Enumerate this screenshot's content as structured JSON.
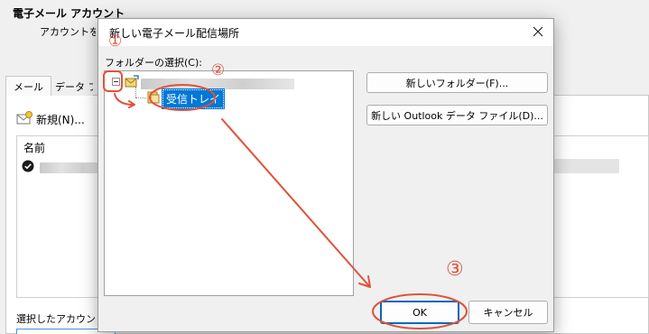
{
  "background": {
    "title": "電子メール アカウント",
    "description": "アカウントを追",
    "tabs": [
      {
        "label": "メール"
      },
      {
        "label": "データ ファ"
      }
    ],
    "new_button": "新規(N)...",
    "list_header": "名前",
    "bottom_label": "選択したアカウント"
  },
  "dialog": {
    "title": "新しい電子メール配信場所",
    "folder_label": "フォルダーの選択(C):",
    "tree": {
      "child_label": "受信トレイ"
    },
    "buttons": {
      "new_folder": "新しいフォルダー(F)...",
      "new_data_file": "新しい Outlook データ ファイル(D)...",
      "ok": "OK",
      "cancel": "キャンセル"
    }
  },
  "annotations": {
    "color": "#e0533a",
    "marks": [
      {
        "label": "①"
      },
      {
        "label": "②"
      },
      {
        "label": "③"
      }
    ]
  },
  "colors": {
    "selection": "#0078d7",
    "dialog_bg": "#f0f0f0",
    "ok_border": "#0067c0"
  },
  "icons": [
    "envelope-icon",
    "check-circle-icon",
    "mailbox-root-icon",
    "folder-icon",
    "close-icon",
    "tree-expander-icon"
  ]
}
